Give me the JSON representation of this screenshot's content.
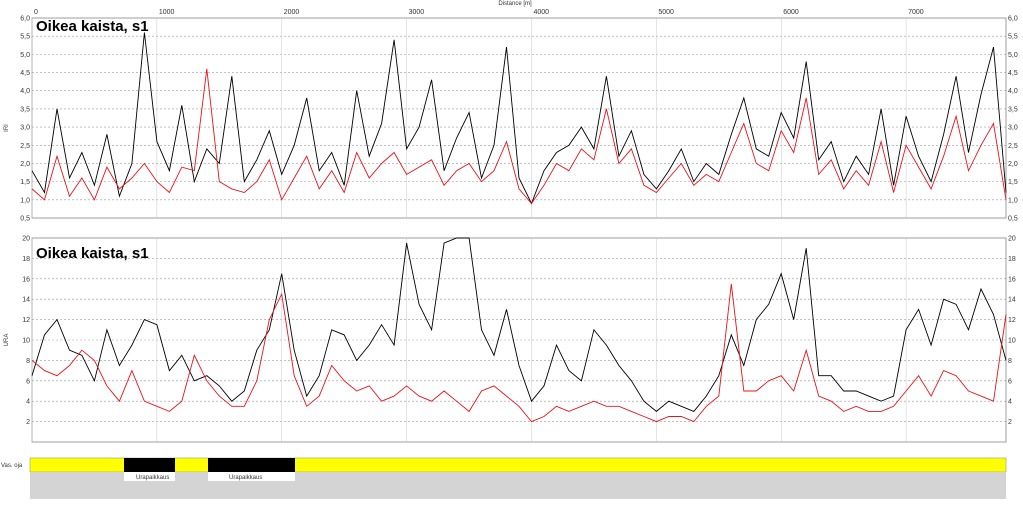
{
  "header": {
    "xlabel": "Distance [m]",
    "x_ticks": [
      "0",
      "1000",
      "2000",
      "3000",
      "4000",
      "5000",
      "6000",
      "7000"
    ]
  },
  "panel1": {
    "title": "Oikea kaista, s1",
    "ylabel": "IRI",
    "y_ticks": [
      "0,5",
      "1,0",
      "1,5",
      "2,0",
      "2,5",
      "3,0",
      "3,5",
      "4,0",
      "4,5",
      "5,0",
      "5,5",
      "6,0"
    ]
  },
  "panel2": {
    "title": "Oikea kaista, s1",
    "ylabel": "URA",
    "y_ticks": [
      "2",
      "4",
      "6",
      "8",
      "10",
      "12",
      "14",
      "16",
      "18",
      "20"
    ]
  },
  "strip": {
    "label": "Vas. oja",
    "segment_label_1": "Urapaikkaus",
    "segment_label_2": "Urapaikkaus"
  },
  "colors": {
    "series_black": "#000000",
    "series_red": "#e8141c",
    "strip_yellow": "#ffff00",
    "strip_black": "#000000",
    "bottom_gray": "#d4d4d4"
  },
  "chart_data": [
    {
      "type": "line",
      "title": "Oikea kaista, s1",
      "xlabel": "Distance [m]",
      "ylabel": "IRI",
      "xlim": [
        0,
        7800
      ],
      "ylim": [
        0.5,
        6.0
      ],
      "grid": true,
      "series": [
        {
          "color": "black",
          "x": [
            0,
            100,
            200,
            300,
            400,
            500,
            600,
            700,
            800,
            900,
            1000,
            1100,
            1200,
            1300,
            1400,
            1500,
            1600,
            1700,
            1800,
            1900,
            2000,
            2100,
            2200,
            2300,
            2400,
            2500,
            2600,
            2700,
            2800,
            2900,
            3000,
            3100,
            3200,
            3300,
            3400,
            3500,
            3600,
            3700,
            3800,
            3900,
            4000,
            4100,
            4200,
            4300,
            4400,
            4500,
            4600,
            4700,
            4800,
            4900,
            5000,
            5100,
            5200,
            5300,
            5400,
            5500,
            5600,
            5700,
            5800,
            5900,
            6000,
            6100,
            6200,
            6300,
            6400,
            6500,
            6600,
            6700,
            6800,
            6900,
            7000,
            7100,
            7200,
            7300,
            7400,
            7500,
            7600,
            7700,
            7800
          ],
          "y": [
            1.8,
            1.2,
            3.5,
            1.6,
            2.3,
            1.4,
            2.8,
            1.1,
            2.0,
            5.6,
            2.6,
            1.8,
            3.6,
            1.5,
            2.4,
            2.0,
            4.4,
            1.5,
            2.1,
            2.9,
            1.7,
            2.5,
            3.8,
            1.8,
            2.3,
            1.4,
            4.0,
            2.2,
            3.1,
            5.4,
            2.4,
            3.0,
            4.3,
            1.8,
            2.7,
            3.4,
            1.6,
            2.5,
            5.2,
            1.6,
            0.9,
            1.8,
            2.3,
            2.5,
            3.0,
            2.4,
            4.4,
            2.2,
            2.9,
            1.7,
            1.3,
            1.8,
            2.4,
            1.5,
            2.0,
            1.7,
            2.8,
            3.8,
            2.4,
            2.2,
            3.4,
            2.7,
            4.8,
            2.1,
            2.6,
            1.5,
            2.2,
            1.7,
            3.5,
            1.4,
            3.3,
            2.2,
            1.5,
            2.8,
            4.4,
            2.3,
            3.9,
            5.2,
            1.2
          ]
        },
        {
          "color": "red",
          "x": [
            0,
            100,
            200,
            300,
            400,
            500,
            600,
            700,
            800,
            900,
            1000,
            1100,
            1200,
            1300,
            1400,
            1500,
            1600,
            1700,
            1800,
            1900,
            2000,
            2100,
            2200,
            2300,
            2400,
            2500,
            2600,
            2700,
            2800,
            2900,
            3000,
            3100,
            3200,
            3300,
            3400,
            3500,
            3600,
            3700,
            3800,
            3900,
            4000,
            4100,
            4200,
            4300,
            4400,
            4500,
            4600,
            4700,
            4800,
            4900,
            5000,
            5100,
            5200,
            5300,
            5400,
            5500,
            5600,
            5700,
            5800,
            5900,
            6000,
            6100,
            6200,
            6300,
            6400,
            6500,
            6600,
            6700,
            6800,
            6900,
            7000,
            7100,
            7200,
            7300,
            7400,
            7500,
            7600,
            7700,
            7800
          ],
          "y": [
            1.3,
            1.0,
            2.2,
            1.1,
            1.6,
            1.0,
            1.9,
            1.3,
            1.6,
            2.0,
            1.5,
            1.2,
            1.9,
            1.8,
            4.6,
            1.5,
            1.3,
            1.2,
            1.5,
            2.1,
            1.0,
            1.6,
            2.2,
            1.3,
            1.8,
            1.2,
            2.3,
            1.6,
            2.0,
            2.3,
            1.7,
            1.9,
            2.1,
            1.4,
            1.8,
            2.0,
            1.5,
            1.8,
            2.6,
            1.3,
            0.9,
            1.4,
            2.0,
            1.8,
            2.4,
            2.1,
            3.5,
            2.0,
            2.4,
            1.4,
            1.2,
            1.6,
            2.0,
            1.4,
            1.7,
            1.5,
            2.3,
            3.1,
            2.0,
            1.8,
            2.9,
            2.3,
            3.8,
            1.7,
            2.1,
            1.3,
            1.8,
            1.4,
            2.6,
            1.2,
            2.5,
            1.9,
            1.3,
            2.2,
            3.3,
            1.8,
            2.5,
            3.1,
            1.0
          ]
        }
      ]
    },
    {
      "type": "line",
      "title": "Oikea kaista, s1",
      "xlabel": "Distance [m]",
      "ylabel": "URA",
      "xlim": [
        0,
        7800
      ],
      "ylim": [
        0,
        20
      ],
      "grid": true,
      "series": [
        {
          "color": "black",
          "x": [
            0,
            100,
            200,
            300,
            400,
            500,
            600,
            700,
            800,
            900,
            1000,
            1100,
            1200,
            1300,
            1400,
            1500,
            1600,
            1700,
            1800,
            1900,
            2000,
            2100,
            2200,
            2300,
            2400,
            2500,
            2600,
            2700,
            2800,
            2900,
            3000,
            3100,
            3200,
            3300,
            3400,
            3500,
            3600,
            3700,
            3800,
            3900,
            4000,
            4100,
            4200,
            4300,
            4400,
            4500,
            4600,
            4700,
            4800,
            4900,
            5000,
            5100,
            5200,
            5300,
            5400,
            5500,
            5600,
            5700,
            5800,
            5900,
            6000,
            6100,
            6200,
            6300,
            6400,
            6500,
            6600,
            6700,
            6800,
            6900,
            7000,
            7100,
            7200,
            7300,
            7400,
            7500,
            7600,
            7700,
            7800
          ],
          "y": [
            6.5,
            10.5,
            12.0,
            9.0,
            8.5,
            6.0,
            11.0,
            7.5,
            9.5,
            12.0,
            11.5,
            7.0,
            8.5,
            6.0,
            6.5,
            5.5,
            4.0,
            5.0,
            9.0,
            11.0,
            16.5,
            9.0,
            4.5,
            6.5,
            11.0,
            10.5,
            8.0,
            9.5,
            11.5,
            9.5,
            19.5,
            13.5,
            11.0,
            19.5,
            20.0,
            20.0,
            11.0,
            8.5,
            13.0,
            7.5,
            4.0,
            5.5,
            9.5,
            7.0,
            6.0,
            11.0,
            9.5,
            7.5,
            6.0,
            4.0,
            3.0,
            4.0,
            3.5,
            3.0,
            4.5,
            6.5,
            10.5,
            7.5,
            12.0,
            13.5,
            16.5,
            12.0,
            19.0,
            6.5,
            6.5,
            5.0,
            5.0,
            4.5,
            4.0,
            4.5,
            11.0,
            13.0,
            9.5,
            14.0,
            13.5,
            11.0,
            15.0,
            12.5,
            8.0
          ]
        },
        {
          "color": "red",
          "x": [
            0,
            100,
            200,
            300,
            400,
            500,
            600,
            700,
            800,
            900,
            1000,
            1100,
            1200,
            1300,
            1400,
            1500,
            1600,
            1700,
            1800,
            1900,
            2000,
            2100,
            2200,
            2300,
            2400,
            2500,
            2600,
            2700,
            2800,
            2900,
            3000,
            3100,
            3200,
            3300,
            3400,
            3500,
            3600,
            3700,
            3800,
            3900,
            4000,
            4100,
            4200,
            4300,
            4400,
            4500,
            4600,
            4700,
            4800,
            4900,
            5000,
            5100,
            5200,
            5300,
            5400,
            5500,
            5600,
            5700,
            5800,
            5900,
            6000,
            6100,
            6200,
            6300,
            6400,
            6500,
            6600,
            6700,
            6800,
            6900,
            7000,
            7100,
            7200,
            7300,
            7400,
            7500,
            7600,
            7700,
            7800
          ],
          "y": [
            8.0,
            7.0,
            6.5,
            7.5,
            9.0,
            8.0,
            5.5,
            4.0,
            7.0,
            4.0,
            3.5,
            3.0,
            4.0,
            8.5,
            6.0,
            4.5,
            3.5,
            3.5,
            6.0,
            12.0,
            14.5,
            6.5,
            3.5,
            4.5,
            7.5,
            6.0,
            5.0,
            5.5,
            4.0,
            4.5,
            5.5,
            4.5,
            4.0,
            5.0,
            4.0,
            3.0,
            5.0,
            5.5,
            4.5,
            3.5,
            2.0,
            2.5,
            3.5,
            3.0,
            3.5,
            4.0,
            3.5,
            3.5,
            3.0,
            2.5,
            2.0,
            2.5,
            2.5,
            2.0,
            3.5,
            4.5,
            15.5,
            5.0,
            5.0,
            6.0,
            6.5,
            5.0,
            9.0,
            4.5,
            4.0,
            3.0,
            3.5,
            3.0,
            3.0,
            3.5,
            5.0,
            6.5,
            4.5,
            7.0,
            6.5,
            5.0,
            4.5,
            4.0,
            12.5
          ]
        }
      ]
    }
  ]
}
